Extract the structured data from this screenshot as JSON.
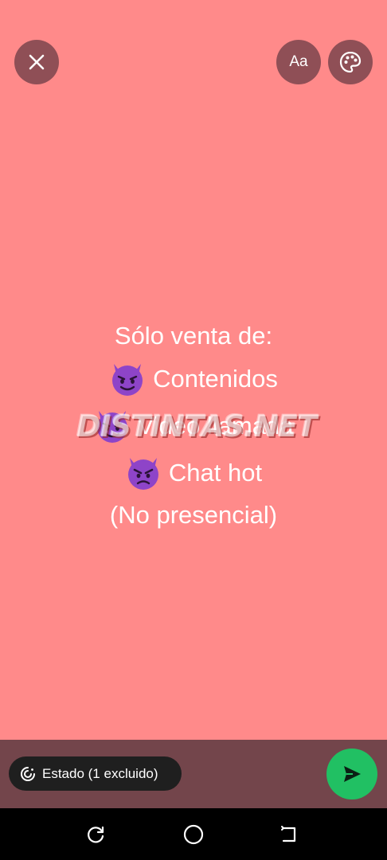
{
  "header": {
    "close_icon": "close-icon",
    "font_button_label": "Aa",
    "palette_icon": "palette-icon"
  },
  "status": {
    "lines": [
      {
        "text": "Sólo venta de:",
        "emoji": ""
      },
      {
        "text": "Contenidos",
        "emoji": "smiling-devil-emoji"
      },
      {
        "text": "Video llamada",
        "emoji": "smiling-devil-emoji"
      },
      {
        "text": "Chat hot",
        "emoji": "angry-devil-emoji"
      },
      {
        "text": "(No presencial)",
        "emoji": ""
      }
    ],
    "watermark": "DISTINTAS.NET"
  },
  "colors": {
    "background": "#ff8a8a",
    "button_bg": "#8f4f56",
    "bottom_bar": "#73454b",
    "chip_bg": "#1f1f1f",
    "send": "#21c063",
    "emoji_purple": "#8e44c8"
  },
  "footer": {
    "audience_label": "Estado (1 excluido)",
    "audience_icon": "privacy-ring-icon",
    "send_icon": "send-arrow-icon"
  },
  "navigation": {
    "recents_icon": "recents-icon",
    "home_icon": "home-icon",
    "back_icon": "back-icon"
  }
}
